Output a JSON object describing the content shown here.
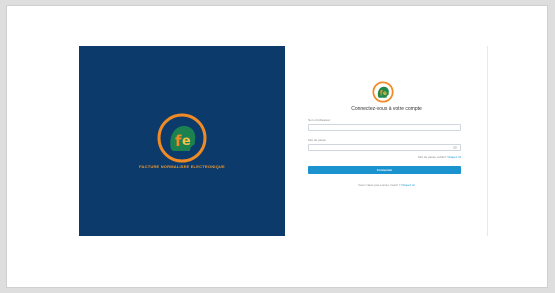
{
  "brand": {
    "name": "FACTURE NORMALISEE ELECTRONIQUE",
    "logo_icon": "fne-logo-icon",
    "panel_color": "#0c3a6b",
    "text_color": "#f39a2b"
  },
  "login": {
    "title": "Connectez-vous à votre compte",
    "username_label": "Nom d'utilisateur",
    "username_value": "",
    "password_label": "Mot de passe",
    "password_value": "",
    "password_toggle_icon": "eye-off-icon",
    "forgot_prefix": "Mot de passe oublié?",
    "forgot_link": "Cliquez ici",
    "submit_label": "Connexion",
    "signup_prefix": "Vous n'êtes pas encore inscrit ?",
    "signup_link": "Cliquez ici",
    "accent_color": "#1a93cf"
  }
}
